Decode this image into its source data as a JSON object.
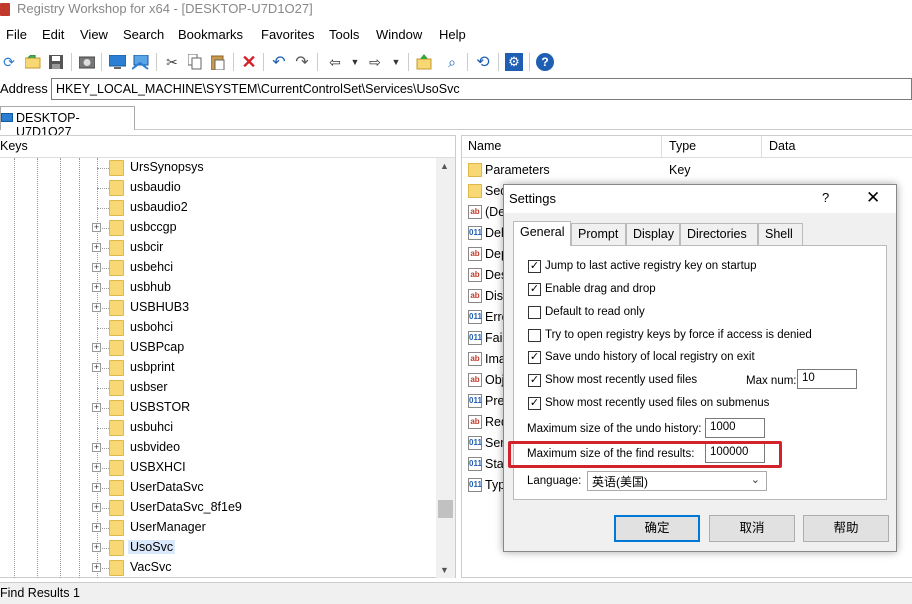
{
  "window": {
    "title": "Registry Workshop for x64 - [DESKTOP-U7D1O27]"
  },
  "menu": [
    "File",
    "Edit",
    "View",
    "Search",
    "Bookmarks",
    "Favorites",
    "Tools",
    "Window",
    "Help"
  ],
  "toolbar": {
    "icons": [
      "refresh-icon",
      "open-icon",
      "save-icon",
      "screenshot-icon",
      "computer-icon",
      "connect-icon",
      "cut-icon",
      "copy-icon",
      "paste-icon",
      "delete-icon",
      "undo-icon",
      "redo-icon",
      "back-icon",
      "forward-icon",
      "export-icon",
      "find-icon",
      "reload-icon",
      "settings-icon",
      "help-icon"
    ]
  },
  "address": {
    "label": "Address",
    "value": "HKEY_LOCAL_MACHINE\\SYSTEM\\CurrentControlSet\\Services\\UsoSvc"
  },
  "tab": {
    "label": "DESKTOP-U7D1O27"
  },
  "keys_pane": {
    "header": "Keys",
    "items": [
      {
        "label": "UrsSynopsys",
        "expandable": false
      },
      {
        "label": "usbaudio",
        "expandable": false
      },
      {
        "label": "usbaudio2",
        "expandable": false
      },
      {
        "label": "usbccgp",
        "expandable": true
      },
      {
        "label": "usbcir",
        "expandable": true
      },
      {
        "label": "usbehci",
        "expandable": true
      },
      {
        "label": "usbhub",
        "expandable": true
      },
      {
        "label": "USBHUB3",
        "expandable": true
      },
      {
        "label": "usbohci",
        "expandable": false
      },
      {
        "label": "USBPcap",
        "expandable": true
      },
      {
        "label": "usbprint",
        "expandable": true
      },
      {
        "label": "usbser",
        "expandable": false
      },
      {
        "label": "USBSTOR",
        "expandable": true
      },
      {
        "label": "usbuhci",
        "expandable": false
      },
      {
        "label": "usbvideo",
        "expandable": true
      },
      {
        "label": "USBXHCI",
        "expandable": true
      },
      {
        "label": "UserDataSvc",
        "expandable": true
      },
      {
        "label": "UserDataSvc_8f1e9",
        "expandable": true
      },
      {
        "label": "UserManager",
        "expandable": true
      },
      {
        "label": "UsoSvc",
        "expandable": true,
        "selected": true
      },
      {
        "label": "VacSvc",
        "expandable": true
      }
    ]
  },
  "values_pane": {
    "columns": {
      "name": "Name",
      "type": "Type",
      "data": "Data"
    },
    "rows": [
      {
        "icon": "folder",
        "name": "Parameters",
        "type": "Key"
      },
      {
        "icon": "folder",
        "name": "Sec",
        "type": ""
      },
      {
        "icon": "ab",
        "name": "(De",
        "type": ""
      },
      {
        "icon": "bin",
        "name": "Del",
        "type": ""
      },
      {
        "icon": "ab",
        "name": "Dep",
        "type": ""
      },
      {
        "icon": "ab",
        "name": "Des",
        "type": ""
      },
      {
        "icon": "ab",
        "name": "Dis",
        "type": ""
      },
      {
        "icon": "bin",
        "name": "Erro",
        "type": ""
      },
      {
        "icon": "bin",
        "name": "Fail",
        "type": ""
      },
      {
        "icon": "ab",
        "name": "Ima",
        "type": ""
      },
      {
        "icon": "ab",
        "name": "Obj",
        "type": ""
      },
      {
        "icon": "bin",
        "name": "Pre",
        "type": ""
      },
      {
        "icon": "ab",
        "name": "Req",
        "type": ""
      },
      {
        "icon": "bin",
        "name": "Ser",
        "type": ""
      },
      {
        "icon": "bin",
        "name": "Sta",
        "type": ""
      },
      {
        "icon": "bin",
        "name": "Typ",
        "type": ""
      }
    ]
  },
  "status": {
    "text": "Find Results 1"
  },
  "settings": {
    "title": "Settings",
    "help": "?",
    "close": "✕",
    "tabs": [
      "General",
      "Prompt",
      "Display",
      "Directories",
      "Shell"
    ],
    "active_tab": "General",
    "checkboxes": [
      {
        "label": "Jump to last active registry key on startup",
        "checked": true
      },
      {
        "label": "Enable drag and drop",
        "checked": true
      },
      {
        "label": "Default to read only",
        "checked": false
      },
      {
        "label": "Try to open registry keys by force if access is denied",
        "checked": false
      },
      {
        "label": "Save undo history of local registry on exit",
        "checked": true
      },
      {
        "label": "Show most recently used files",
        "checked": true
      },
      {
        "label": "Show most recently used files on submenus",
        "checked": true
      }
    ],
    "max_num_label": "Max num:",
    "max_num_value": "10",
    "undo_label": "Maximum size of the undo history:",
    "undo_value": "1000",
    "find_label": "Maximum size of the find results:",
    "find_value": "100000",
    "language_label": "Language:",
    "language_value": "英语(美国)",
    "buttons": {
      "ok": "确定",
      "cancel": "取消",
      "help": "帮助"
    },
    "highlight_color": "#d3232a"
  }
}
